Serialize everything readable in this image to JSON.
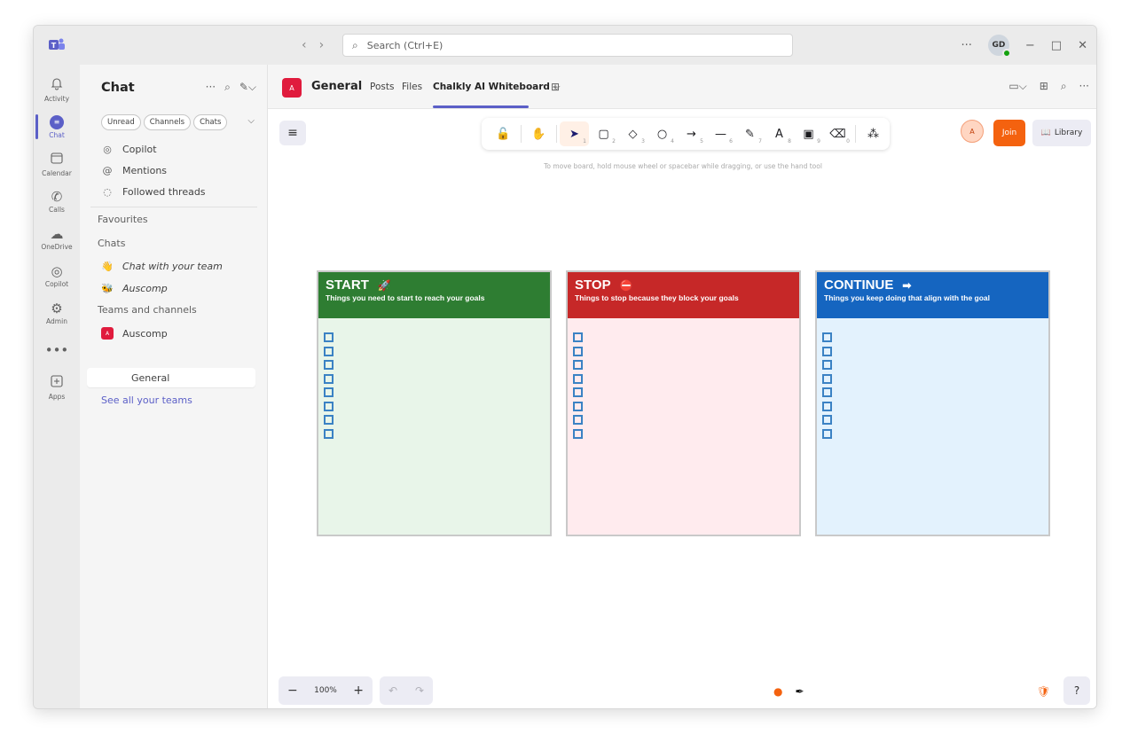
{
  "titlebar": {
    "search_placeholder": "Search (Ctrl+E)",
    "more": "···",
    "user_initials": "GD",
    "minimize": "−",
    "maximize": "□",
    "close": "✕"
  },
  "rail": [
    {
      "label": "Activity",
      "icon": "bell-icon"
    },
    {
      "label": "Chat",
      "icon": "chat-icon"
    },
    {
      "label": "Calendar",
      "icon": "calendar-icon"
    },
    {
      "label": "Calls",
      "icon": "phone-icon"
    },
    {
      "label": "OneDrive",
      "icon": "cloud-icon"
    },
    {
      "label": "Copilot",
      "icon": "copilot-icon"
    },
    {
      "label": "Admin",
      "icon": "admin-icon"
    },
    {
      "label": "",
      "icon": "more-icon"
    },
    {
      "label": "Apps",
      "icon": "apps-icon"
    }
  ],
  "sidebar": {
    "title": "Chat",
    "filters": [
      "Unread",
      "Channels",
      "Chats"
    ],
    "quick": [
      {
        "label": "Copilot",
        "icon": "copilot-icon"
      },
      {
        "label": "Mentions",
        "icon": "at-icon"
      },
      {
        "label": "Followed threads",
        "icon": "followed-icon"
      }
    ],
    "favourites": "Favourites",
    "chats_header": "Chats",
    "chats": [
      {
        "label": "Chat with your team"
      },
      {
        "label": "Auscomp"
      }
    ],
    "teams_header": "Teams and channels",
    "team": {
      "badge": "A",
      "name": "Auscomp"
    },
    "channel": "General",
    "see_all": "See all your teams"
  },
  "channel": {
    "badge": "A",
    "name": "General",
    "tabs": [
      "Posts",
      "Files",
      "Chalkly AI Whiteboard"
    ],
    "tab_chevron": "⌵"
  },
  "whiteboard": {
    "hint": "To move board, hold mouse wheel or spacebar while dragging, or use the hand tool",
    "tools": [
      {
        "icon": "lock-icon",
        "num": ""
      },
      {
        "icon": "hand-icon",
        "num": ""
      },
      {
        "icon": "pointer-icon",
        "num": "1"
      },
      {
        "icon": "rectangle-icon",
        "num": "2"
      },
      {
        "icon": "diamond-icon",
        "num": "3"
      },
      {
        "icon": "ellipse-icon",
        "num": "4"
      },
      {
        "icon": "arrow-icon",
        "num": "5"
      },
      {
        "icon": "line-icon",
        "num": "6"
      },
      {
        "icon": "pencil-icon",
        "num": "7"
      },
      {
        "icon": "text-icon",
        "num": "8"
      },
      {
        "icon": "image-icon",
        "num": "9"
      },
      {
        "icon": "eraser-icon",
        "num": "0"
      },
      {
        "icon": "shapes-icon",
        "num": ""
      }
    ],
    "collaborator_initial": "A",
    "join": "Join",
    "library": "Library",
    "zoom": "100%",
    "cards": [
      {
        "title": "START",
        "emoji": "🚀",
        "subtitle": "Things you need to start to reach your goals",
        "head_color": "#2e7d32",
        "body_color": "#e8f5e9",
        "checkboxes": 8
      },
      {
        "title": "STOP",
        "emoji": "⛔",
        "subtitle": "Things to stop because they block your goals",
        "head_color": "#c62828",
        "body_color": "#ffebee",
        "checkboxes": 8
      },
      {
        "title": "CONTINUE",
        "emoji": "➡",
        "subtitle": "Things you keep doing that align with the goal",
        "head_color": "#1565c0",
        "body_color": "#e3f2fd",
        "checkboxes": 8
      }
    ]
  }
}
